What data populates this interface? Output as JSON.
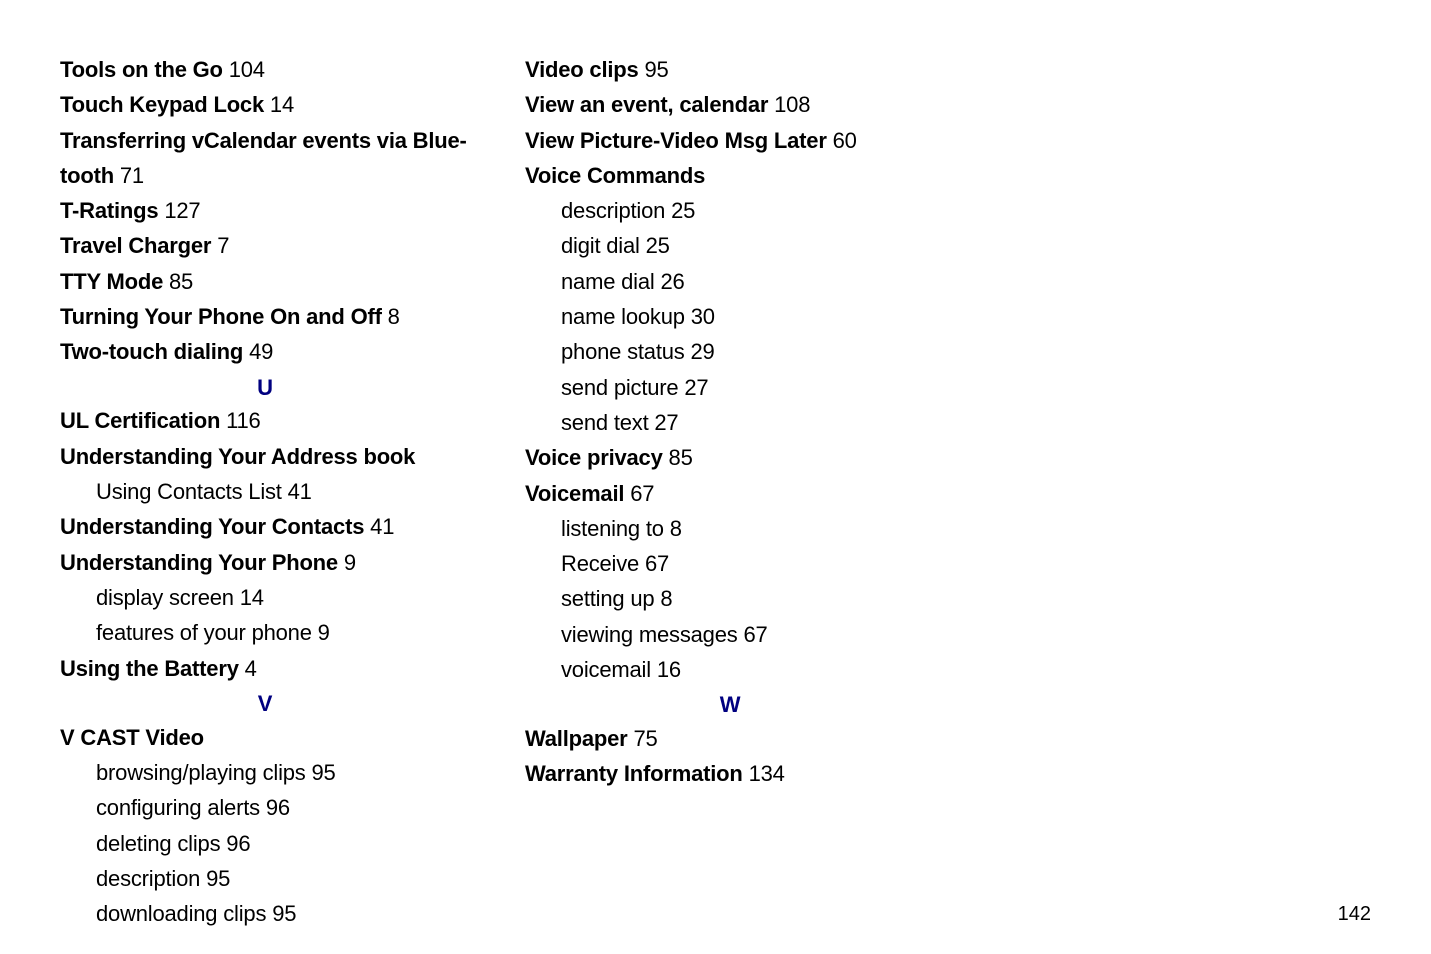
{
  "page_number": "142",
  "section_letters": {
    "U": "U",
    "V": "V",
    "W": "W"
  },
  "col1": [
    {
      "bold": "Tools on the Go",
      "page": " 104"
    },
    {
      "bold": "Touch Keypad Lock",
      "page": " 14"
    },
    {
      "bold": "Transferring vCalendar events via Blue-",
      "page": ""
    },
    {
      "bold": "tooth",
      "page": " 71"
    },
    {
      "bold": "T-Ratings",
      "page": " 127"
    },
    {
      "bold": "Travel Charger",
      "page": " 7"
    },
    {
      "bold": "TTY Mode",
      "page": " 85"
    },
    {
      "bold": "Turning Your Phone On and Off",
      "page": " 8"
    },
    {
      "bold": "Two-touch dialing",
      "page": " 49"
    },
    {
      "letter": "U"
    },
    {
      "bold": "UL Certification",
      "page": " 116"
    },
    {
      "bold": "Understanding Your Address book",
      "page": ""
    },
    {
      "sub": "Using Contacts List",
      "page": " 41"
    },
    {
      "bold": "Understanding Your Contacts",
      "page": " 41"
    },
    {
      "bold": "Understanding Your Phone",
      "page": " 9"
    },
    {
      "sub": "display screen",
      "page": " 14"
    },
    {
      "sub": "features of your phone",
      "page": " 9"
    },
    {
      "bold": "Using the Battery",
      "page": " 4"
    },
    {
      "letter": "V"
    },
    {
      "bold": "V CAST Video",
      "page": ""
    },
    {
      "sub": "browsing/playing clips",
      "page": " 95"
    },
    {
      "sub": "configuring alerts",
      "page": " 96"
    },
    {
      "sub": "deleting clips",
      "page": " 96"
    },
    {
      "sub": "description",
      "page": " 95"
    },
    {
      "sub": "downloading clips",
      "page": " 95"
    }
  ],
  "col2": [
    {
      "bold": "Video clips",
      "page": " 95"
    },
    {
      "bold": "View an event, calendar",
      "page": " 108"
    },
    {
      "bold": "View Picture-Video Msg Later",
      "page": " 60"
    },
    {
      "bold": "Voice Commands",
      "page": ""
    },
    {
      "sub": "description",
      "page": " 25"
    },
    {
      "sub": "digit dial",
      "page": " 25"
    },
    {
      "sub": "name dial",
      "page": " 26"
    },
    {
      "sub": "name lookup",
      "page": " 30"
    },
    {
      "sub": "phone status",
      "page": " 29"
    },
    {
      "sub": "send picture",
      "page": " 27"
    },
    {
      "sub": "send text",
      "page": " 27"
    },
    {
      "bold": "Voice privacy",
      "page": " 85"
    },
    {
      "bold": "Voicemail",
      "page": " 67"
    },
    {
      "sub": "listening to",
      "page": " 8"
    },
    {
      "sub": "Receive",
      "page": " 67"
    },
    {
      "sub": "setting up",
      "page": " 8"
    },
    {
      "sub": "viewing messages",
      "page": " 67"
    },
    {
      "sub": "voicemail",
      "page": " 16"
    },
    {
      "letter": "W"
    },
    {
      "bold": "Wallpaper",
      "page": " 75"
    },
    {
      "bold": "Warranty Information",
      "page": " 134"
    }
  ]
}
